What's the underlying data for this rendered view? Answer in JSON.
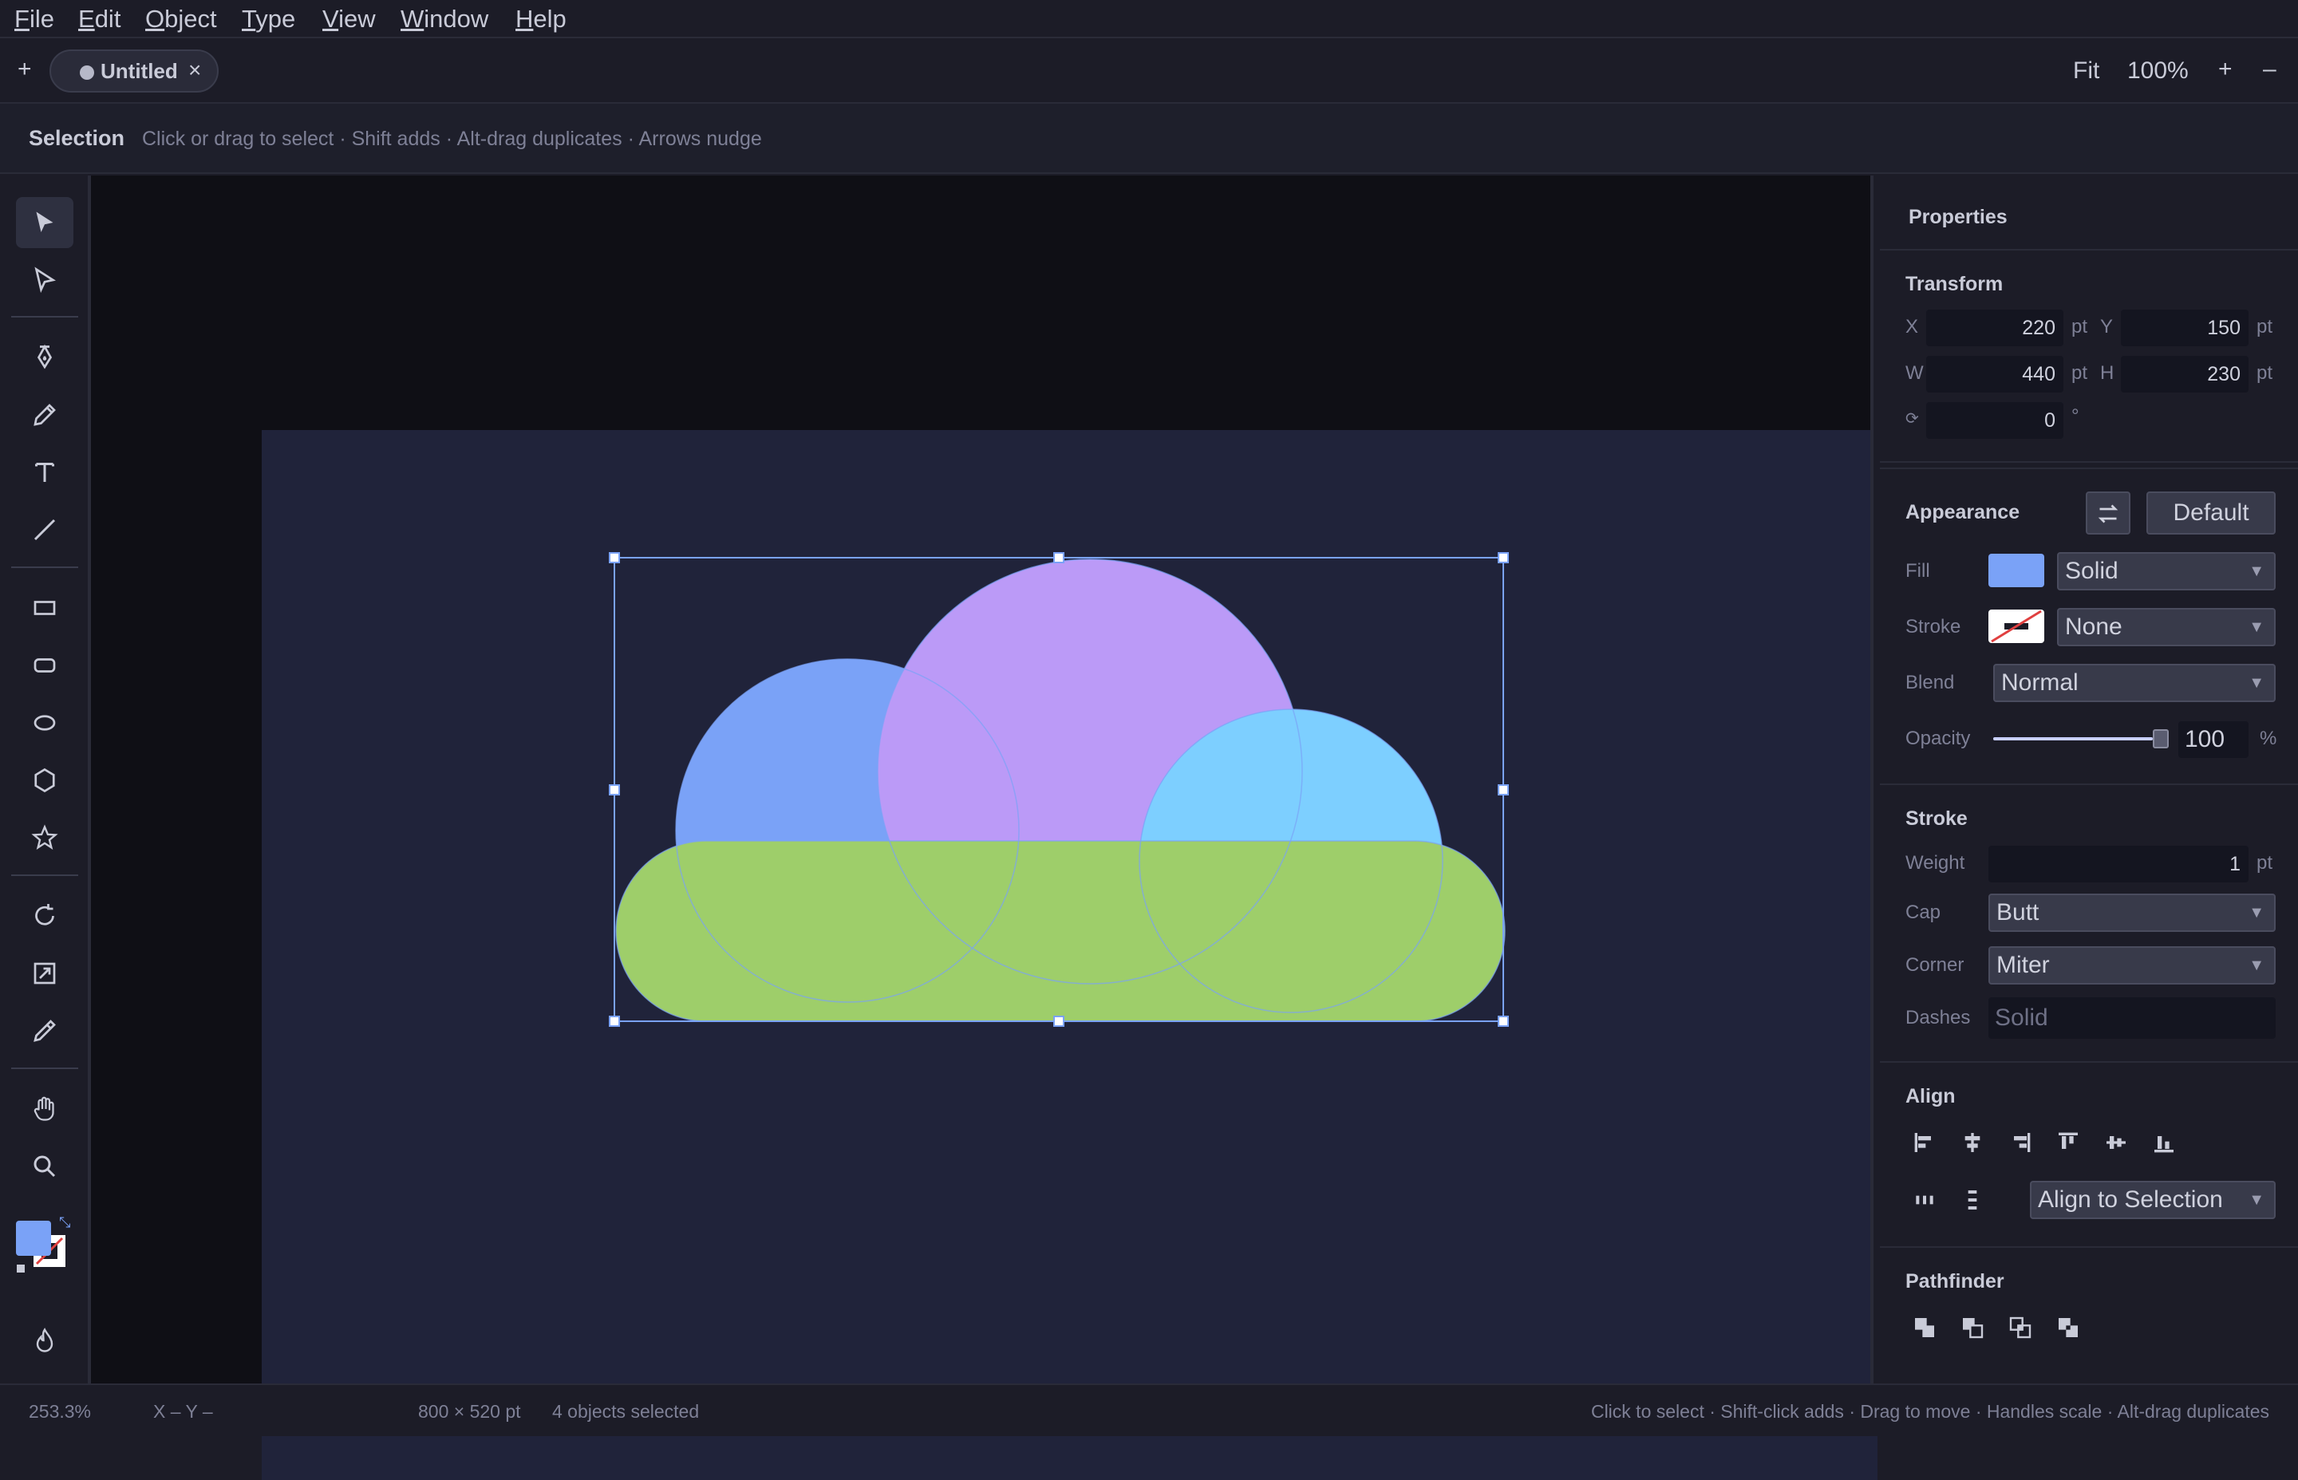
{
  "menu": [
    "File",
    "Edit",
    "Object",
    "Type",
    "View",
    "Window",
    "Help"
  ],
  "tabs": {
    "new_tab": "+",
    "document_title": "Untitled",
    "close": "×",
    "fit_label": "Fit",
    "zoom_level": "100%",
    "zoom_in": "+",
    "zoom_out": "–"
  },
  "hint": {
    "tool_name": "Selection",
    "tool_hint": "Click or drag to select · Shift adds · Alt-drag duplicates · Arrows nudge"
  },
  "tools": [
    "selection-tool",
    "direct-selection-tool",
    "pen-tool",
    "pencil-tool",
    "type-tool",
    "line-tool",
    "rectangle-tool",
    "rounded-rectangle-tool",
    "ellipse-tool",
    "polygon-tool",
    "star-tool",
    "rotate-tool",
    "scale-tool",
    "eyedropper-tool",
    "hand-tool",
    "zoom-tool"
  ],
  "colors": {
    "fill_swatch": "#7aa2f7",
    "circle_left": "#7aa2f7",
    "circle_center": "#bb9af7",
    "circle_right": "#7dcfff",
    "capsule": "#9ece6a",
    "selection": "#7aa2f7"
  },
  "properties": {
    "title": "Properties",
    "transform": {
      "title": "Transform",
      "x_label": "X",
      "x": "220",
      "x_unit": "pt",
      "y_label": "Y",
      "y": "150",
      "y_unit": "pt",
      "w_label": "W",
      "w": "440",
      "w_unit": "pt",
      "h_label": "H",
      "h": "230",
      "h_unit": "pt",
      "rot_label": "⟳",
      "rot": "0",
      "rot_unit": "°"
    },
    "appearance": {
      "title": "Appearance",
      "default_button": "Default",
      "fill_label": "Fill",
      "fill_type": "Solid",
      "stroke_label": "Stroke",
      "stroke_type": "None",
      "blend_label": "Blend",
      "blend_mode": "Normal",
      "opacity_label": "Opacity",
      "opacity_value": "100",
      "opacity_unit": "%",
      "opacity_fraction": 1.0
    },
    "stroke": {
      "title": "Stroke",
      "weight_label": "Weight",
      "weight": "1",
      "weight_unit": "pt",
      "cap_label": "Cap",
      "cap": "Butt",
      "corner_label": "Corner",
      "corner": "Miter",
      "dashes_label": "Dashes",
      "dashes": "Solid"
    },
    "align": {
      "title": "Align",
      "align_to": "Align to Selection"
    },
    "pathfinder": {
      "title": "Pathfinder"
    }
  },
  "status": {
    "zoom": "253.3%",
    "coords": "X –  Y –",
    "artboard_size": "800 × 520 pt",
    "selection_count": "4 objects selected",
    "help": "Click to select · Shift-click adds · Drag to move · Handles scale · Alt-drag duplicates"
  }
}
